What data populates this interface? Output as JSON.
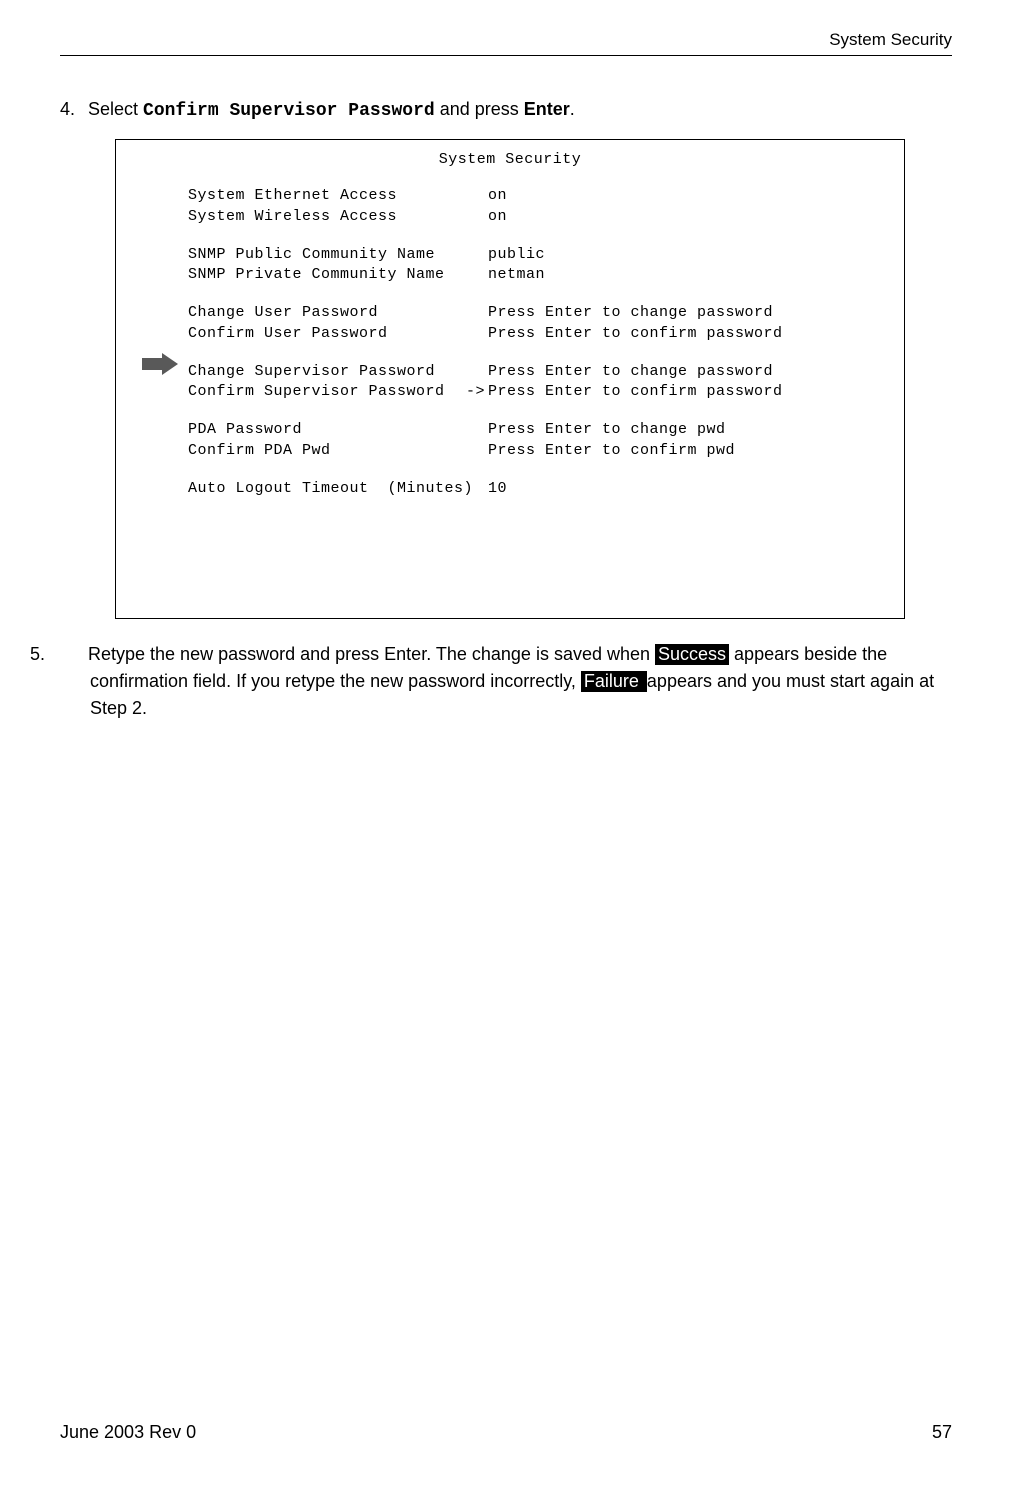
{
  "header": {
    "title": "System Security"
  },
  "step4": {
    "num": "4.",
    "pre": "Select ",
    "mono": "Confirm Supervisor Password",
    "mid": " and press ",
    "bold": "Enter",
    "post": "."
  },
  "screen": {
    "title": "System Security",
    "rows": [
      {
        "label": "System Ethernet Access",
        "value": "on",
        "sel": ""
      },
      {
        "label": "System Wireless Access",
        "value": "on",
        "sel": ""
      },
      {
        "gap": true
      },
      {
        "label": "SNMP Public Community Name",
        "value": "public",
        "sel": ""
      },
      {
        "label": "SNMP Private Community Name",
        "value": "netman",
        "sel": ""
      },
      {
        "gap": true
      },
      {
        "label": "Change User Password",
        "value": "Press Enter to change password",
        "sel": ""
      },
      {
        "label": "Confirm User Password",
        "value": "Press Enter to confirm password",
        "sel": ""
      },
      {
        "gap": true
      },
      {
        "label": "Change Supervisor Password",
        "value": "Press Enter to change password",
        "sel": ""
      },
      {
        "label": "Confirm Supervisor Password",
        "value": "Press Enter to confirm password",
        "sel": "->"
      },
      {
        "gap": true
      },
      {
        "label": "PDA Password",
        "value": "Press Enter to change pwd",
        "sel": ""
      },
      {
        "label": "Confirm PDA Pwd",
        "value": "Press Enter to confirm pwd",
        "sel": ""
      },
      {
        "gap": true
      },
      {
        "label": "Auto Logout Timeout  (Minutes)",
        "value": "10",
        "sel": ""
      }
    ]
  },
  "step5": {
    "num": "5.",
    "t1": "Retype the new password and press Enter. The change is saved when ",
    "inv1": "Success",
    "t2": " appears beside the confirmation field. If you retype the new password incorrectly, ",
    "inv2": "Failure ",
    "t3": " appears and you must start again at Step 2."
  },
  "footer": {
    "left": "June 2003 Rev 0",
    "right": "57"
  }
}
